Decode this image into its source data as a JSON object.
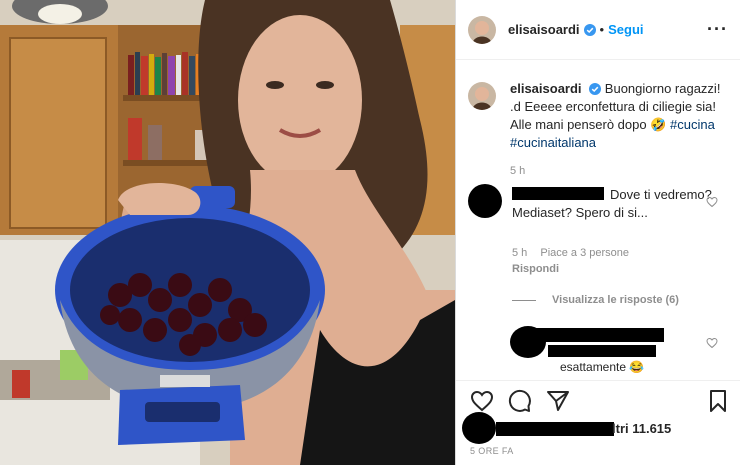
{
  "post": {
    "username": "elisaisoardi",
    "follow_label": "Segui",
    "more_icon": "more-options-icon",
    "caption_text": "Buongiorno ragazzi! .d Eeeee erconfettura di ciliegie sia! Alle mani penserò dopo 🤣",
    "hashtag1": "#cucina",
    "hashtag2": "#cucinaitaliana",
    "caption_time": "5 h"
  },
  "comments": [
    {
      "text": "Dove ti vedremo? Mediaset? Spero di si...",
      "time": "5 h",
      "likes": "Piace a 3 persone",
      "reply": "Rispondi",
      "view_replies": "Visualizza le risposte (6)"
    },
    {
      "text": "esattamente 😂"
    }
  ],
  "likes_text": "ltri 11.615",
  "timestamp": "5 ORE FA",
  "colors": {
    "follow": "#0095f6",
    "hashtag": "#00376b",
    "muted": "#8e8e8e",
    "bowl": "#2f55c8"
  }
}
